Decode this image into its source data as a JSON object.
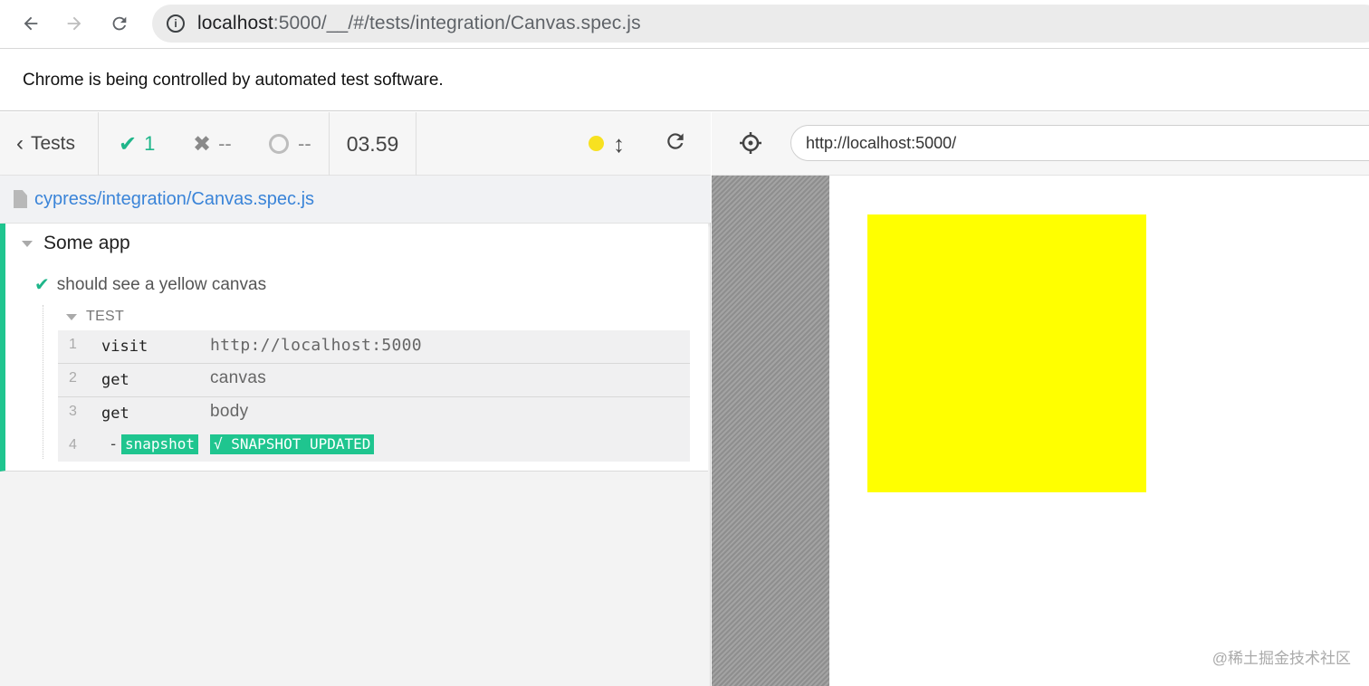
{
  "browser": {
    "url_host": "localhost",
    "url_rest": ":5000/__/#/tests/integration/Canvas.spec.js",
    "infobar_text": "Chrome is being controlled by automated test software."
  },
  "reporter": {
    "tests_label": "Tests",
    "passed_count": "1",
    "failed_count": "--",
    "pending_count": "--",
    "duration": "03.59",
    "spec_path": "cypress/integration/Canvas.spec.js",
    "suite_title": "Some app",
    "test_title": "should see a yellow canvas",
    "hook_label": "TEST",
    "commands": [
      {
        "num": "1",
        "name": "visit",
        "message": "http://localhost:5000"
      },
      {
        "num": "2",
        "name": "get",
        "message": "canvas"
      },
      {
        "num": "3",
        "name": "get",
        "message": "body"
      },
      {
        "num": "4",
        "name": "-",
        "tag1": "snapshot",
        "tag2": "√ SNAPSHOT UPDATED"
      }
    ]
  },
  "aut": {
    "url": "http://localhost:5000/",
    "canvas_color": "#ffff00"
  },
  "watermark": "@稀土掘金技术社区",
  "colors": {
    "passed": "#1fb68a",
    "running_dot": "#f7e120",
    "link": "#3a84d8"
  }
}
